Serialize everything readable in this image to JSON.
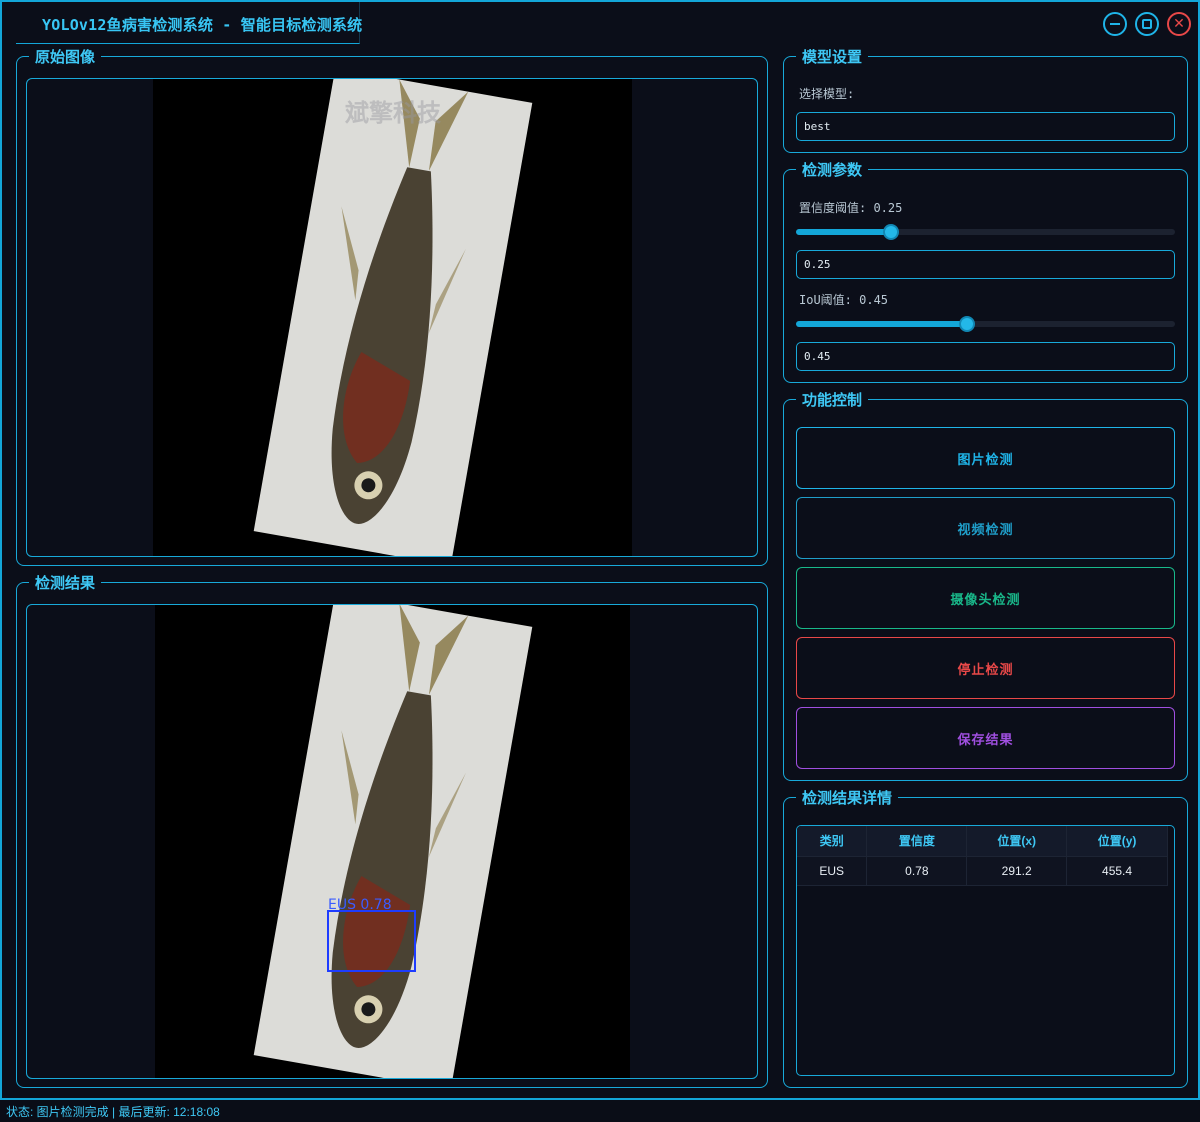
{
  "window": {
    "title": "YOLOv12鱼病害检测系统 - 智能目标检测系统"
  },
  "panels": {
    "original": {
      "title": "原始图像"
    },
    "result": {
      "title": "检测结果"
    },
    "model": {
      "title": "模型设置",
      "select_label": "选择模型:",
      "selected_model": "best"
    },
    "params": {
      "title": "检测参数",
      "confidence_label": "置信度阈值: 0.25",
      "confidence_value": "0.25",
      "confidence_level": 0.25,
      "iou_label": "IoU阈值: 0.45",
      "iou_value": "0.45",
      "iou_level": 0.45
    },
    "controls": {
      "title": "功能控制",
      "buttons": [
        {
          "label": "图片检测",
          "color": "#1fb4e8"
        },
        {
          "label": "视频检测",
          "color": "#1f9ec9"
        },
        {
          "label": "摄像头检测",
          "color": "#19b88a"
        },
        {
          "label": "停止检测",
          "color": "#e84848"
        },
        {
          "label": "保存结果",
          "color": "#a04fe0"
        }
      ]
    },
    "details": {
      "title": "检测结果详情",
      "columns": [
        "类别",
        "置信度",
        "位置(x)",
        "位置(y)"
      ],
      "rows": [
        [
          "EUS",
          "0.78",
          "291.2",
          "455.4"
        ]
      ]
    }
  },
  "detection": {
    "box_label": "EUS 0.78",
    "box_color": "#1e3cff"
  },
  "watermark": "斌擎科技",
  "status": "状态: 图片检测完成 | 最后更新: 12:18:08",
  "colors": {
    "accent": "#13a6d8",
    "background": "#0b0e19"
  }
}
